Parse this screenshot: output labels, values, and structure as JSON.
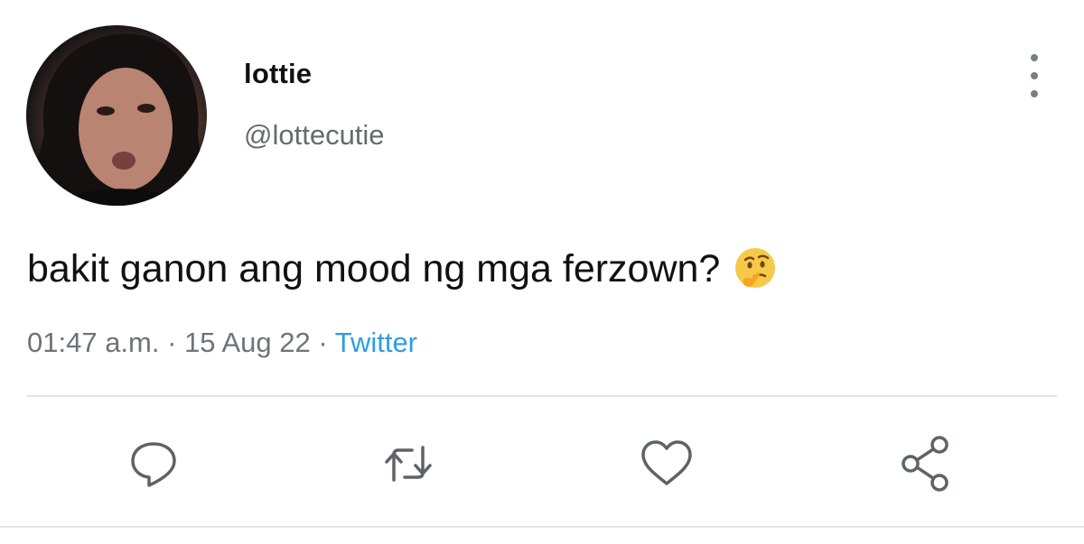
{
  "author": {
    "display_name": "lottie",
    "handle": "@lottecutie"
  },
  "tweet": {
    "text": "bakit ganon ang mood ng mga ferzown?",
    "emoji": "thinking-face-icon",
    "time": "01:47 a.m.",
    "separator": "·",
    "date": "15 Aug 22",
    "source": "Twitter"
  },
  "actions": [
    "reply-icon",
    "retweet-icon",
    "like-icon",
    "share-icon"
  ],
  "colors": {
    "text": "#111111",
    "secondary": "#6e7378",
    "link": "#2f9ddf",
    "icon": "#5f6368",
    "divider": "#e3e6e8"
  }
}
